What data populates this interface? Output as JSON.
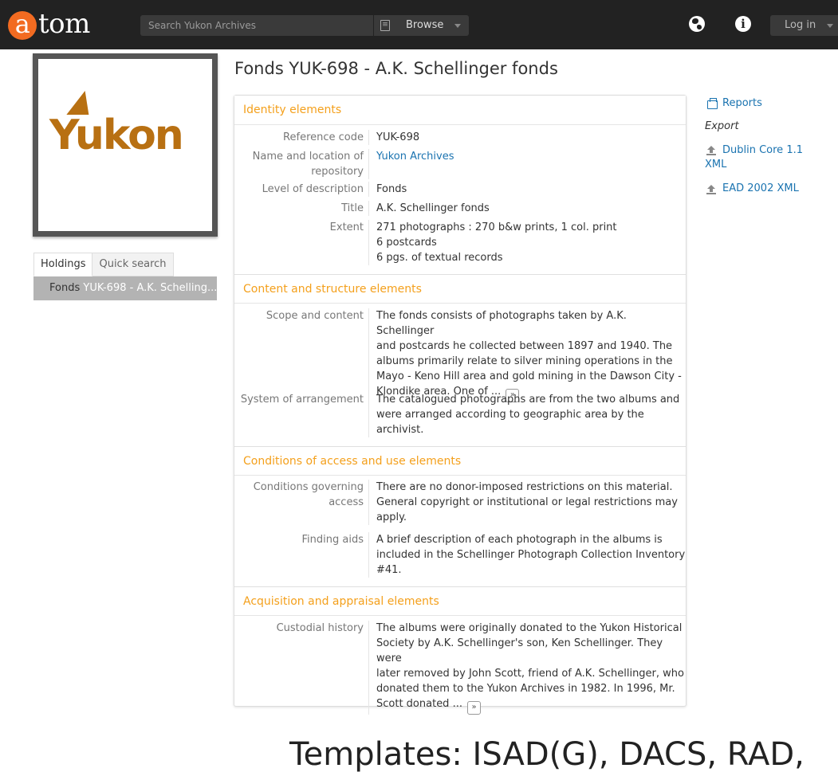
{
  "topbar": {
    "logo_letter": "a",
    "logo_rest": "tom",
    "search_placeholder": "Search Yukon Archives",
    "browse_label": "Browse",
    "login_label": "Log in"
  },
  "sidebar": {
    "logo_text": "Yukon",
    "tabs": [
      "Holdings",
      "Quick search"
    ],
    "holding_prefix": "Fonds",
    "holding_title": "YUK-698 - A.K. Schelling..."
  },
  "main": {
    "title": "Fonds YUK-698 - A.K. Schellinger fonds",
    "sections": {
      "identity": {
        "heading": "Identity elements",
        "reference_label": "Reference code",
        "reference_value": "YUK-698",
        "repo_label_1": "Name and location of",
        "repo_label_2": "repository",
        "repo_value": "Yukon Archives",
        "level_label": "Level of description",
        "level_value": "Fonds",
        "title_label": "Title",
        "title_value": "A.K. Schellinger fonds",
        "extent_label": "Extent",
        "extent_lines": [
          "271 photographs : 270 b&w prints, 1 col. print",
          "6 postcards",
          "6 pgs. of textual records"
        ]
      },
      "content": {
        "heading": "Content and structure elements",
        "scope_label": "Scope and content",
        "scope_lines": [
          "The fonds consists of photographs taken by A.K. Schellinger",
          "and postcards he collected between 1897 and 1940. The",
          "albums primarily relate to silver mining operations in the",
          "Mayo - Keno Hill area and gold mining in the Dawson City -",
          "Klondike area. One of ..."
        ],
        "more_label": "»",
        "arrangement_label": "System of arrangement",
        "arrangement_lines": [
          "The catalogued photographs are from the two albums and",
          "were arranged according to geographic area by the",
          "archivist."
        ]
      },
      "access": {
        "heading": "Conditions of access and use elements",
        "access_label_1": "Conditions governing",
        "access_label_2": "access",
        "access_lines": [
          "There are no donor-imposed restrictions on this material.",
          "General copyright or institutional or legal restrictions may",
          "apply."
        ],
        "finding_label": "Finding aids",
        "finding_lines": [
          "A brief description of each photograph in the albums is",
          "included in the Schellinger Photograph Collection Inventory",
          "#41."
        ]
      },
      "acquisition": {
        "heading": "Acquisition and appraisal elements",
        "custodial_label": "Custodial history",
        "custodial_lines": [
          "The albums were originally donated to the Yukon Historical",
          "Society by A.K. Schellinger's son, Ken Schellinger. They were",
          "later removed by John Scott, friend of A.K. Schellinger, who",
          "donated them to the Yukon Archives in 1982. In 1996, Mr.",
          "Scott donated ..."
        ],
        "more_label": "»"
      }
    }
  },
  "actions": {
    "reports_label": "Reports",
    "export_label": "Export",
    "dublin_core_1": "Dublin Core 1.1",
    "dublin_core_2": "XML",
    "ead_label": "EAD 2002 XML"
  },
  "footer_caption": "Templates: ISAD(G), DACS, RAD,"
}
